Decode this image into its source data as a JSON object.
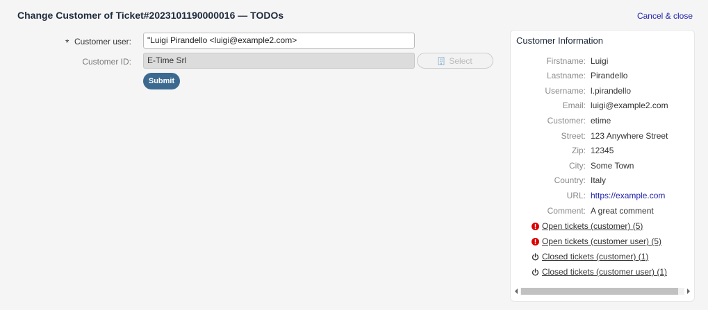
{
  "header": {
    "title": "Change Customer of Ticket#2023101190000016 — TODOs",
    "cancel_label": "Cancel & close"
  },
  "form": {
    "customer_user_label": "Customer user:",
    "mandatory_mark": "*",
    "customer_user_value": "\"Luigi Pirandello  <luigi@example2.com>",
    "customer_id_label": "Customer ID:",
    "customer_id_value": "E-Time Srl",
    "select_label": "Select",
    "submit_label": "Submit"
  },
  "customer_info": {
    "title": "Customer Information",
    "fields": [
      {
        "key": "Firstname:",
        "value": "Luigi"
      },
      {
        "key": "Lastname:",
        "value": "Pirandello"
      },
      {
        "key": "Username:",
        "value": "l.pirandello"
      },
      {
        "key": "Email:",
        "value": "luigi@example2.com"
      },
      {
        "key": "Customer:",
        "value": "etime"
      },
      {
        "key": "Street:",
        "value": "123 Anywhere Street"
      },
      {
        "key": "Zip:",
        "value": "12345"
      },
      {
        "key": "City:",
        "value": "Some Town"
      },
      {
        "key": "Country:",
        "value": "Italy"
      },
      {
        "key": "URL:",
        "value": "https://example.com"
      },
      {
        "key": "Comment:",
        "value": "A great comment"
      }
    ],
    "ticket_links": [
      {
        "label": "Open tickets (customer) (5)",
        "icon": "exclamation-circle-icon"
      },
      {
        "label": "Open tickets (customer user) (5)",
        "icon": "exclamation-circle-icon"
      },
      {
        "label": "Closed tickets (customer) (1)",
        "icon": "power-icon"
      },
      {
        "label": "Closed tickets (customer user) (1)",
        "icon": "power-icon"
      }
    ]
  },
  "colors": {
    "accent": "#3b6990",
    "link": "#2222aa",
    "alert": "#dd0000"
  }
}
